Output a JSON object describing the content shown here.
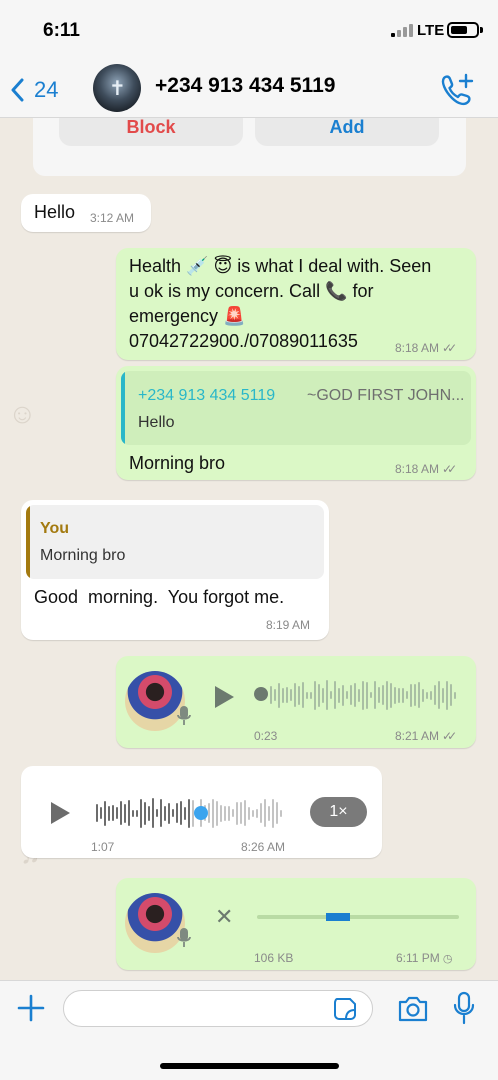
{
  "status_bar": {
    "time": "6:11",
    "network": "LTE"
  },
  "header": {
    "back_count": "24",
    "contact": "+234 913 434 5119"
  },
  "contact_card": {
    "block_label": "Block",
    "add_label": "Add"
  },
  "messages": [
    {
      "text": "Hello",
      "time": "3:12 AM"
    },
    {
      "text_lines": [
        "Health 💉 😇 is what I deal with. Seen",
        "u ok is my concern. Call 📞 for",
        "emergency 🚨",
        "07042722900./07089011635"
      ],
      "time": "8:18 AM"
    },
    {
      "quote_name": "+234 913 434 5119",
      "quote_extra": "~GOD FIRST JOHN...",
      "quote_text": "Hello",
      "text": "Morning bro",
      "time": "8:18 AM"
    },
    {
      "quote_name": "You",
      "quote_text": "Morning bro",
      "text": "Good  morning.  You forgot me.",
      "time": "8:19 AM"
    },
    {
      "duration": "0:23",
      "time": "8:21 AM"
    },
    {
      "duration": "1:07",
      "time": "8:26 AM",
      "speed": "1×"
    },
    {
      "size": "106 KB",
      "time": "6:11 PM"
    }
  ],
  "colors": {
    "accent": "#1a7fd0",
    "outgoing": "#dbf8c6",
    "incoming": "#ffffff",
    "quote_out": "#29b7c9",
    "quote_in": "#a37a10",
    "chat_bg": "#efeae2"
  }
}
